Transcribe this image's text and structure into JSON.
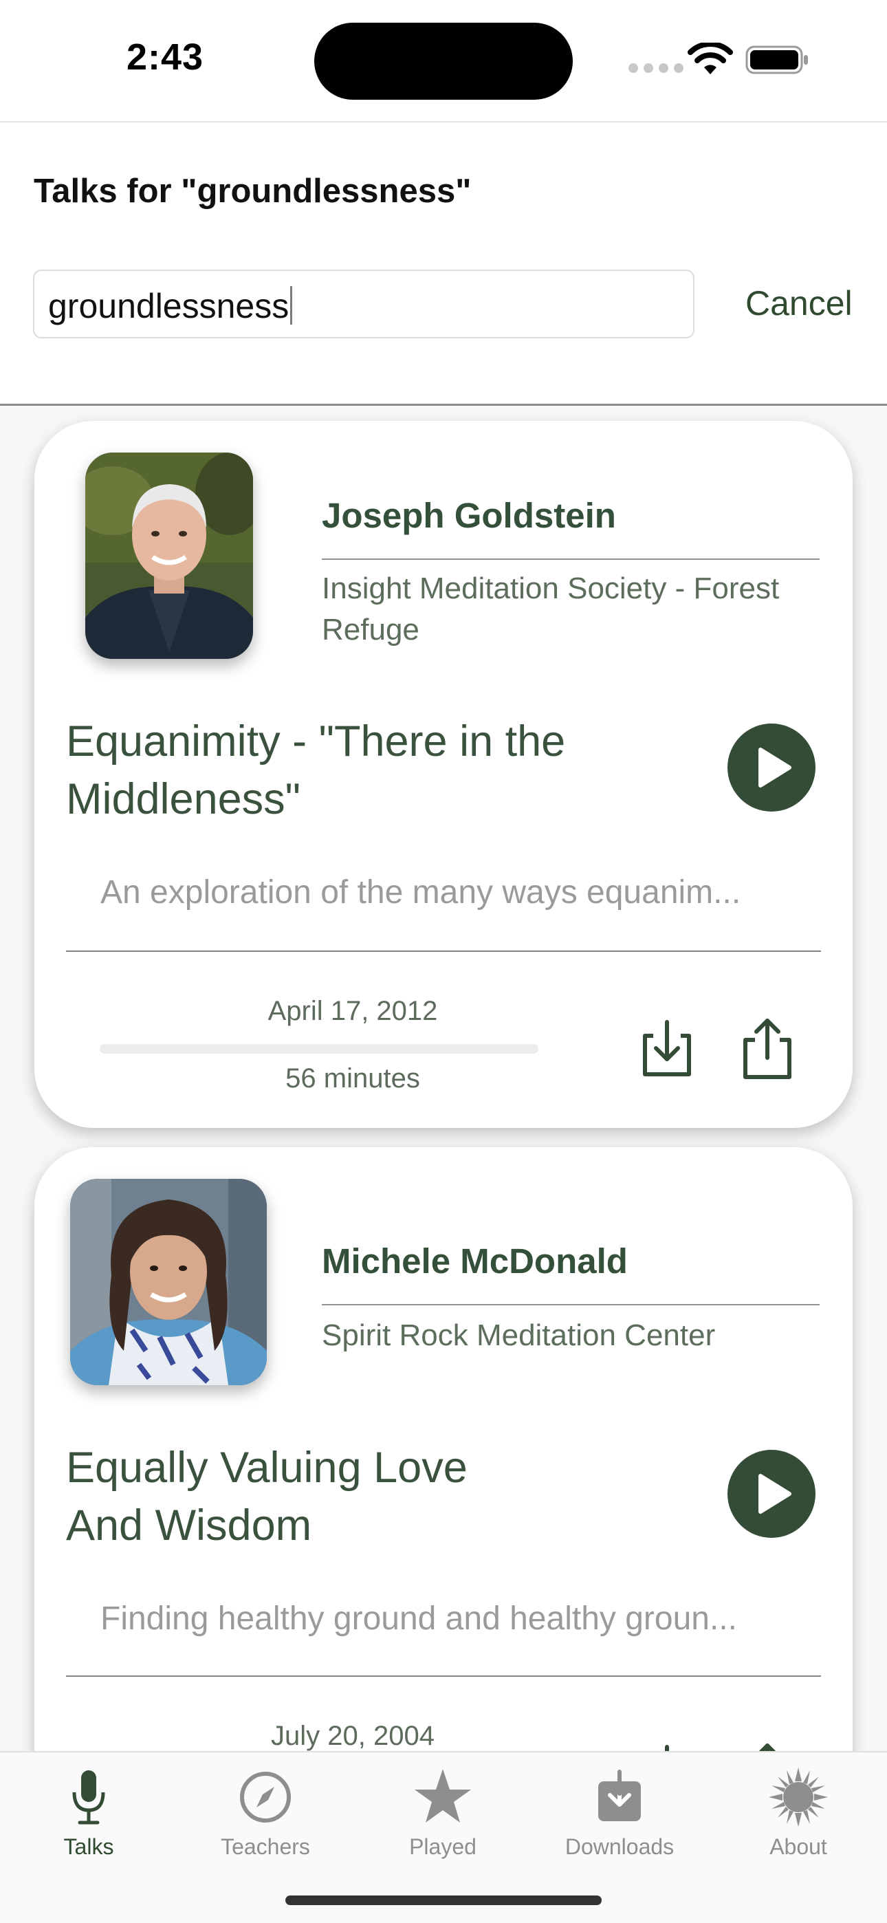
{
  "status": {
    "time": "2:43"
  },
  "header": {
    "title": "Talks for \"groundlessness\"",
    "search_value": "groundlessness",
    "cancel_label": "Cancel"
  },
  "talks": [
    {
      "teacher": "Joseph Goldstein",
      "place": "Insight Meditation Society - Forest Refuge",
      "title": "Equanimity - \"There in the Middleness\"",
      "description": "An exploration of the many ways equanim...",
      "date": "April 17, 2012",
      "duration": "56 minutes",
      "progress": 0
    },
    {
      "teacher": "Michele McDonald",
      "place": "Spirit Rock Meditation Center",
      "title": "Equally Valuing Love And Wisdom",
      "description": "Finding healthy ground and healthy groun...",
      "date": "July 20, 2004"
    }
  ],
  "tabs": [
    {
      "label": "Talks",
      "icon": "microphone-icon",
      "active": true
    },
    {
      "label": "Teachers",
      "icon": "compass-icon",
      "active": false
    },
    {
      "label": "Played",
      "icon": "star-icon",
      "active": false
    },
    {
      "label": "Downloads",
      "icon": "download-tray-icon",
      "active": false
    },
    {
      "label": "About",
      "icon": "sunburst-icon",
      "active": false
    }
  ],
  "colors": {
    "accent": "#344b36",
    "text_green": "#3a513d",
    "inactive_tab": "#8e8e8e"
  }
}
